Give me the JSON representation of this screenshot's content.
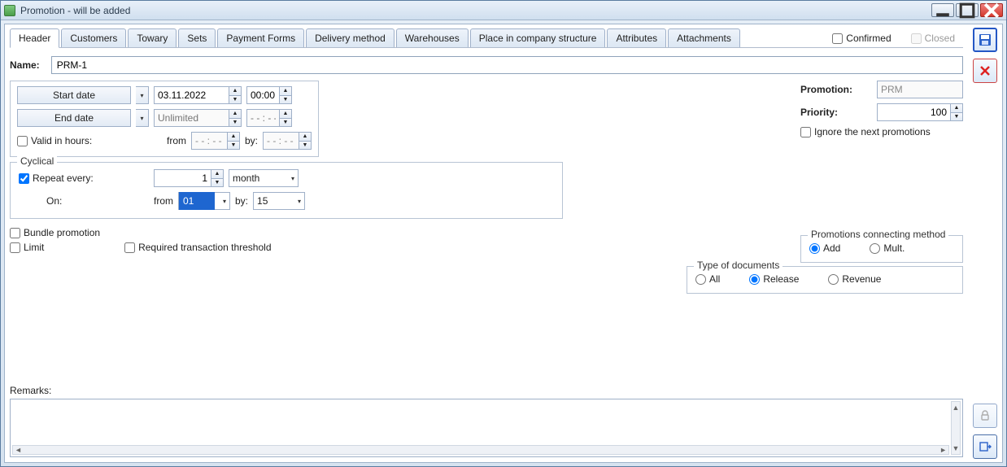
{
  "window": {
    "title": "Promotion - will be added"
  },
  "tabs": {
    "items": [
      "Header",
      "Customers",
      "Towary",
      "Sets",
      "Payment Forms",
      "Delivery method",
      "Warehouses",
      "Place in company structure",
      "Attributes",
      "Attachments"
    ],
    "active": 0
  },
  "top_checks": {
    "confirmed": "Confirmed",
    "closed": "Closed"
  },
  "name": {
    "label": "Name:",
    "value": "PRM-1"
  },
  "dates": {
    "start_label": "Start date",
    "start_date": "03.11.2022",
    "start_time": "00:00",
    "end_label": "End date",
    "end_date_placeholder": "Unlimited",
    "end_time_placeholder": "- - : - -"
  },
  "valid_hours": {
    "label": "Valid in hours:",
    "from_label": "from",
    "from_value": "- - : - -",
    "by_label": "by:",
    "by_value": "- - : - -"
  },
  "cyclical": {
    "legend": "Cyclical",
    "repeat_label": "Repeat every:",
    "repeat_value": "1",
    "repeat_unit": "month",
    "on_label": "On:",
    "from_label": "from",
    "from_value": "01",
    "by_label": "by:",
    "by_value": "15"
  },
  "flags": {
    "bundle": "Bundle promotion",
    "limit": "Limit",
    "threshold": "Required transaction threshold"
  },
  "right": {
    "promotion_label": "Promotion:",
    "promotion_value": "PRM",
    "priority_label": "Priority:",
    "priority_value": "100",
    "ignore_label": "Ignore the next promotions"
  },
  "connecting": {
    "legend": "Promotions connecting method",
    "add": "Add",
    "mult": "Mult."
  },
  "doctype": {
    "legend": "Type of documents",
    "all": "All",
    "release": "Release",
    "revenue": "Revenue"
  },
  "remarks": {
    "label": "Remarks:"
  }
}
